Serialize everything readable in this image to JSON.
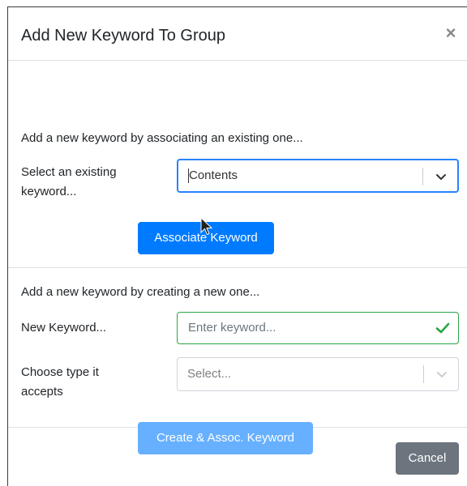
{
  "modal": {
    "title": "Add New Keyword To Group",
    "close_symbol": "×"
  },
  "associate_section": {
    "heading": "Add a new keyword by associating an existing one...",
    "select_label": "Select an existing keyword...",
    "select_value": "Contents",
    "button_label": "Associate Keyword"
  },
  "create_section": {
    "heading": "Add a new keyword by creating a new one...",
    "keyword_label": "New Keyword...",
    "keyword_placeholder": "Enter keyword...",
    "keyword_valid": true,
    "type_label": "Choose type it accepts",
    "type_placeholder": "Select...",
    "button_label": "Create & Assoc. Keyword",
    "button_disabled": true
  },
  "footer": {
    "cancel_label": "Cancel"
  },
  "colors": {
    "primary": "#007bff",
    "primary_disabled": "#66b0ff",
    "secondary": "#6c757d",
    "valid": "#28a745",
    "focus": "#2684ff"
  },
  "icons": {
    "close": "close-icon",
    "select_open": "chevron-down-icon",
    "valid": "check-icon",
    "pointer": "mouse-pointer-icon"
  }
}
